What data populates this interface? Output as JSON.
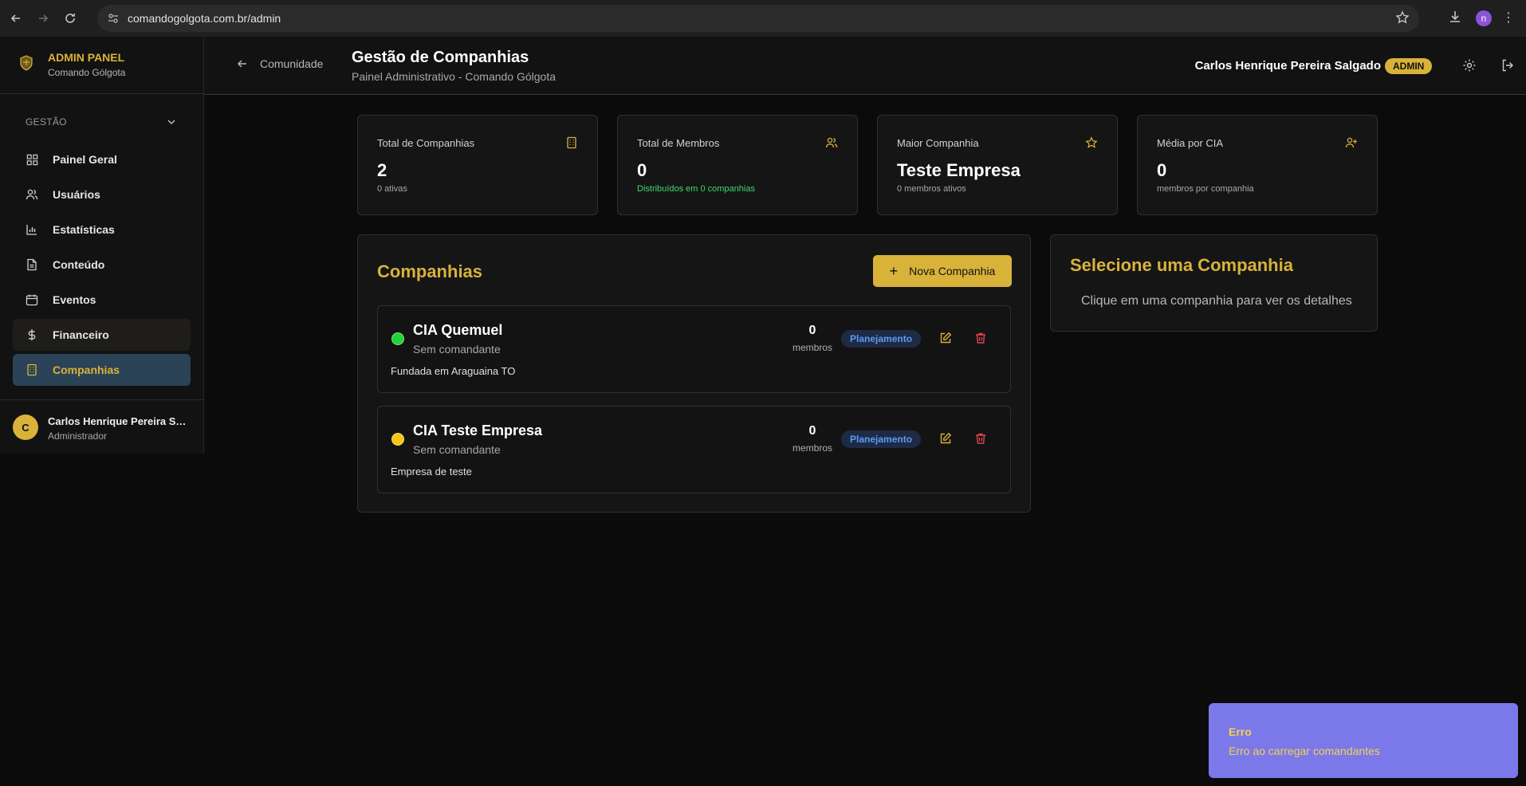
{
  "browser": {
    "url": "comandogolgota.com.br/admin",
    "profile_initial": "n"
  },
  "sidebar": {
    "brand_title": "ADMIN PANEL",
    "brand_subtitle": "Comando Gólgota",
    "section_label": "GESTÃO",
    "items": [
      {
        "label": "Painel Geral",
        "icon": "grid-icon"
      },
      {
        "label": "Usuários",
        "icon": "users-icon"
      },
      {
        "label": "Estatísticas",
        "icon": "bar-chart-icon"
      },
      {
        "label": "Conteúdo",
        "icon": "document-icon"
      },
      {
        "label": "Eventos",
        "icon": "calendar-icon"
      },
      {
        "label": "Financeiro",
        "icon": "dollar-icon"
      },
      {
        "label": "Companhias",
        "icon": "building-icon"
      }
    ],
    "active_item": "Companhias",
    "user": {
      "initial": "C",
      "name": "Carlos Henrique Pereira Salgado",
      "role": "Administrador"
    }
  },
  "header": {
    "back_label": "Comunidade",
    "title": "Gestão de Companhias",
    "subtitle": "Painel Administrativo - Comando Gólgota",
    "user_name": "Carlos Henrique Pereira Salgado",
    "user_badge": "ADMIN"
  },
  "stats": [
    {
      "label": "Total de Companhias",
      "value": "2",
      "sub": "0 ativas",
      "icon": "building-icon"
    },
    {
      "label": "Total de Membros",
      "value": "0",
      "sub": "Distribuídos em 0 companhias",
      "icon": "users-icon"
    },
    {
      "label": "Maior Companhia",
      "value": "Teste Empresa",
      "sub": "0 membros ativos",
      "icon": "star-icon"
    },
    {
      "label": "Média por CIA",
      "value": "0",
      "sub": "membros por companhia",
      "icon": "user-plus-icon"
    }
  ],
  "companies_panel": {
    "title": "Companhias",
    "new_button": "Nova Companhia",
    "items": [
      {
        "name": "CIA Quemuel",
        "commander": "Sem comandante",
        "description": "Fundada em Araguaina TO",
        "members": "0",
        "members_label": "membros",
        "status": "Planejamento",
        "dot_color": "#22d33a"
      },
      {
        "name": "CIA Teste Empresa",
        "commander": "Sem comandante",
        "description": "Empresa de teste",
        "members": "0",
        "members_label": "membros",
        "status": "Planejamento",
        "dot_color": "#f2c811"
      }
    ]
  },
  "details_panel": {
    "title": "Selecione uma Companhia",
    "hint": "Clique em uma companhia para ver os detalhes"
  },
  "toast": {
    "title": "Erro",
    "message": "Erro ao carregar comandantes"
  },
  "colors": {
    "accent": "#d9b23a",
    "active_nav_bg": "#2b4356",
    "toast_bg": "#7b78ea",
    "status_text": "#5b9cf5",
    "delete": "#e0434c"
  }
}
